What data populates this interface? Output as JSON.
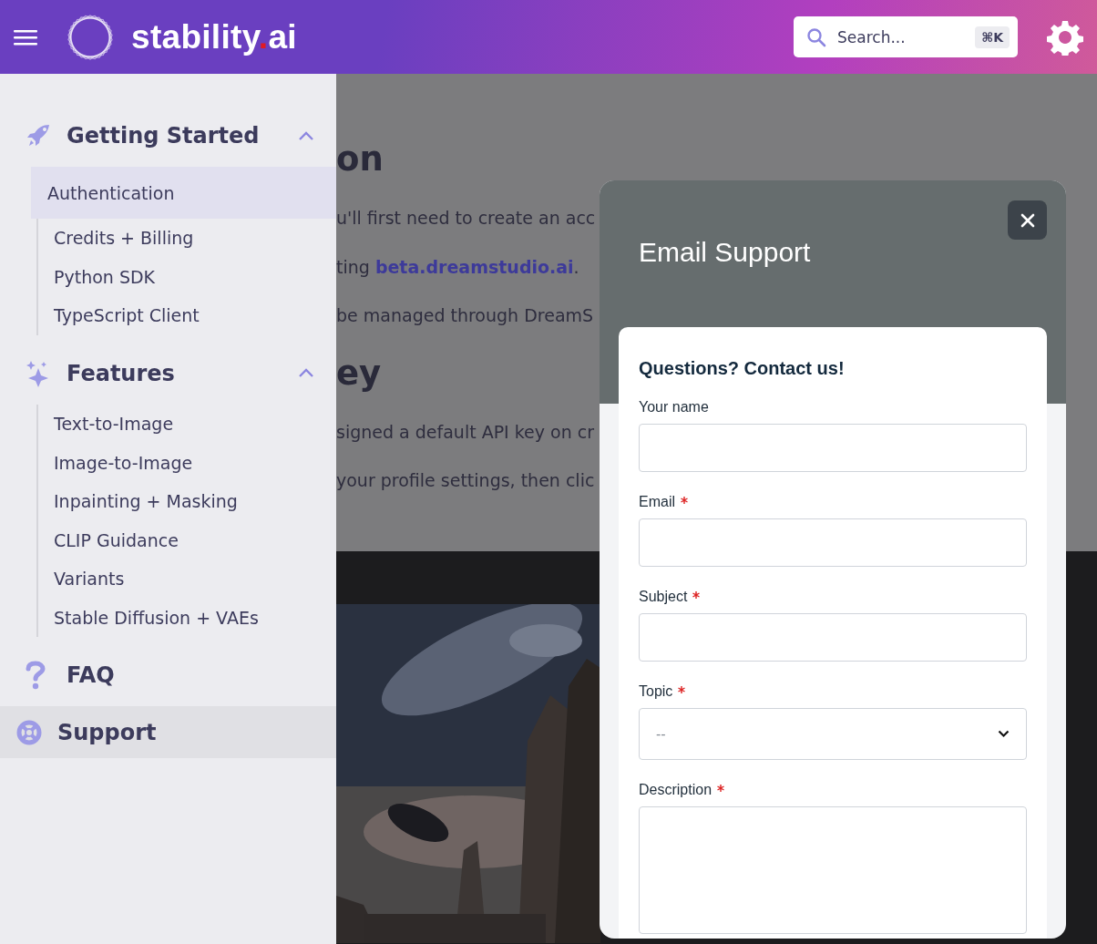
{
  "header": {
    "logo": {
      "name": "stability",
      "dot": ".",
      "suffix": "ai"
    },
    "search": {
      "placeholder": "Search...",
      "shortcut": "⌘K"
    }
  },
  "sidebar": {
    "sections": [
      {
        "label": "Getting Started",
        "selected": false,
        "expanded": true,
        "children": [
          {
            "label": "Authentication",
            "selected": true
          },
          {
            "label": "Credits + Billing",
            "selected": false
          },
          {
            "label": "Python SDK",
            "selected": false
          },
          {
            "label": "TypeScript Client",
            "selected": false
          }
        ]
      },
      {
        "label": "Features",
        "selected": false,
        "expanded": true,
        "children": [
          {
            "label": "Text-to-Image",
            "selected": false
          },
          {
            "label": "Image-to-Image",
            "selected": false
          },
          {
            "label": "Inpainting + Masking",
            "selected": false
          },
          {
            "label": "CLIP Guidance",
            "selected": false
          },
          {
            "label": "Variants",
            "selected": false
          },
          {
            "label": "Stable Diffusion + VAEs",
            "selected": false
          }
        ]
      },
      {
        "label": "FAQ",
        "selected": false
      },
      {
        "label": "Support",
        "selected": true
      }
    ]
  },
  "content": {
    "blocks": [
      {
        "kind": "heading",
        "text": "on"
      },
      {
        "kind": "paragraph",
        "text": "u'll first need to create an acc"
      },
      {
        "kind": "paragraph",
        "text": "ting ",
        "link": "beta.dreamstudio.ai",
        "after": "."
      },
      {
        "kind": "paragraph",
        "text": "be managed through DreamS"
      },
      {
        "kind": "heading",
        "text": "ey"
      },
      {
        "kind": "paragraph",
        "text": "signed a default API key on cr"
      },
      {
        "kind": "paragraph",
        "text": "your profile settings, then clic"
      }
    ]
  },
  "modal": {
    "title": "Email Support",
    "form_title": "Questions? Contact us!",
    "fields": [
      {
        "label": "Your name",
        "required": false,
        "kind": "text"
      },
      {
        "label": "Email",
        "required": true,
        "kind": "text"
      },
      {
        "label": "Subject",
        "required": true,
        "kind": "text"
      },
      {
        "label": "Topic",
        "required": true,
        "kind": "select",
        "placeholder": "--"
      },
      {
        "label": "Description",
        "required": true,
        "kind": "textarea"
      }
    ]
  }
}
